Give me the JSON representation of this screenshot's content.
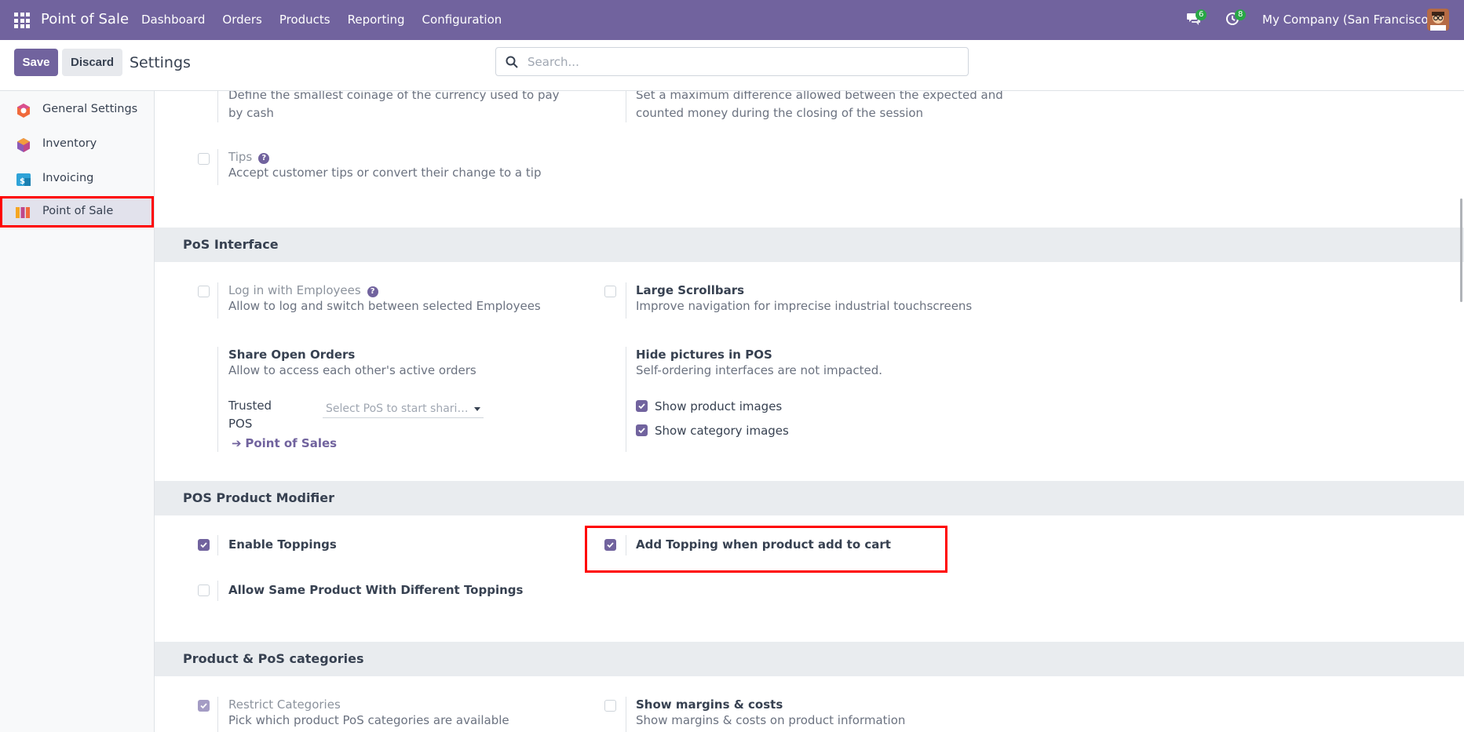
{
  "navbar": {
    "brand": "Point of Sale",
    "menu": [
      "Dashboard",
      "Orders",
      "Products",
      "Reporting",
      "Configuration"
    ],
    "messages_count": "6",
    "activities_count": "8",
    "company": "My Company (San Francisco)"
  },
  "control_panel": {
    "save_label": "Save",
    "discard_label": "Discard",
    "title": "Settings",
    "search_placeholder": "Search..."
  },
  "sidebar": {
    "items": [
      {
        "label": "General Settings",
        "icon": "general-settings-icon"
      },
      {
        "label": "Inventory",
        "icon": "inventory-icon"
      },
      {
        "label": "Invoicing",
        "icon": "invoicing-icon"
      },
      {
        "label": "Point of Sale",
        "icon": "point-of-sale-icon",
        "active": true
      }
    ]
  },
  "payments": {
    "rounding_desc": "Define the smallest coinage of the currency used to pay by cash",
    "difference_desc": "Set a maximum difference allowed between the expected and counted money during the closing of the session",
    "tips_title": "Tips",
    "tips_desc": "Accept customer tips or convert their change to a tip"
  },
  "pos_interface": {
    "heading": "PoS Interface",
    "employees_title": "Log in with Employees",
    "employees_desc": "Allow to log and switch between selected Employees",
    "scrollbars_title": "Large Scrollbars",
    "scrollbars_desc": "Improve navigation for imprecise industrial touchscreens",
    "share_title": "Share Open Orders",
    "share_desc": "Allow to access each other's active orders",
    "trusted_label_1": "Trusted",
    "trusted_label_2": "POS",
    "trusted_placeholder": "Select PoS to start shari…",
    "pos_link": "Point of Sales",
    "hide_pictures_title": "Hide pictures in POS",
    "hide_pictures_desc": "Self-ordering interfaces are not impacted.",
    "show_product_images": "Show product images",
    "show_category_images": "Show category images"
  },
  "product_modifier": {
    "heading": "POS Product Modifier",
    "enable_toppings": "Enable Toppings",
    "add_topping": "Add Topping when product add to cart",
    "allow_same_product": "Allow Same Product With Different Toppings"
  },
  "categories": {
    "heading": "Product & PoS categories",
    "restrict_title": "Restrict Categories",
    "restrict_desc": "Pick which product PoS categories are available",
    "margins_title": "Show margins & costs",
    "margins_desc": "Show margins & costs on product information"
  },
  "colors": {
    "brand": "#71639e",
    "highlight": "#ff0000",
    "badge": "#28a745"
  }
}
